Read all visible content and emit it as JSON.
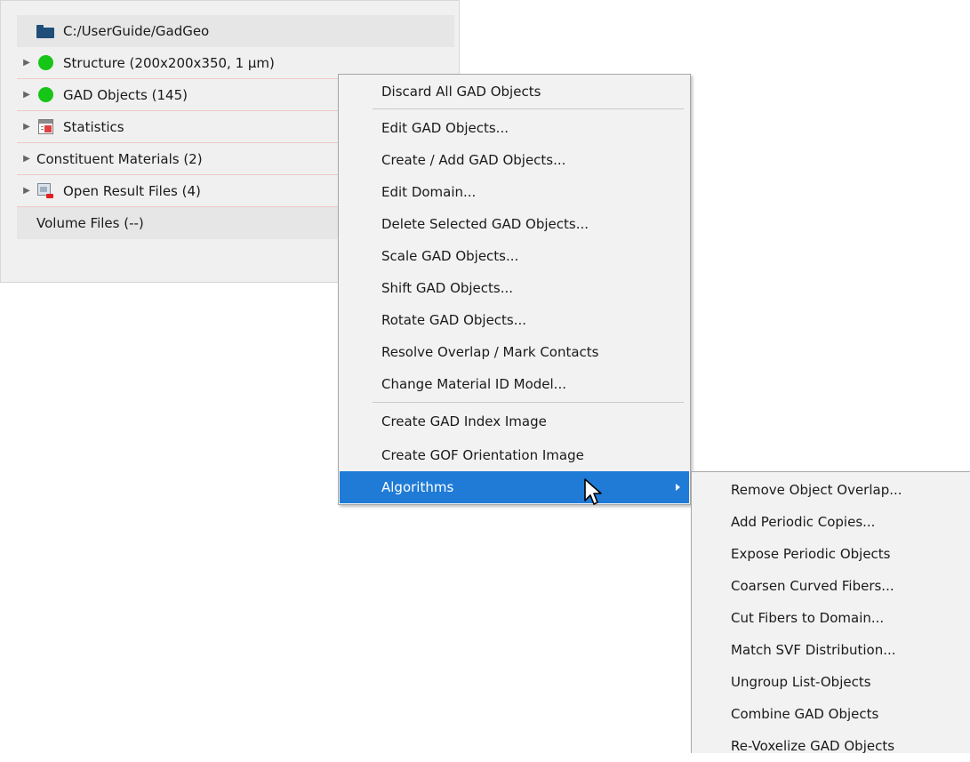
{
  "tree": {
    "root_path": "C:/UserGuide/GadGeo",
    "items": [
      {
        "label": "Structure (200x200x350, 1 µm)",
        "icon": "green-status-dot-icon"
      },
      {
        "label": "GAD Objects (145)",
        "icon": "green-status-dot-icon"
      },
      {
        "label": "Statistics",
        "icon": "statistics-icon"
      },
      {
        "label": "Constituent Materials (2)",
        "icon": ""
      },
      {
        "label": "Open Result Files (4)",
        "icon": "result-file-icon"
      },
      {
        "label": "Volume Files (--)",
        "icon": ""
      }
    ]
  },
  "context_menu": {
    "items": [
      "Discard All GAD Objects",
      "Edit GAD Objects...",
      "Create / Add GAD Objects...",
      "Edit Domain...",
      "Delete Selected GAD Objects...",
      "Scale GAD Objects...",
      "Shift GAD Objects...",
      "Rotate GAD Objects...",
      "Resolve Overlap / Mark Contacts",
      "Change Material ID Model...",
      "Create GAD Index Image",
      "Create GOF Orientation Image",
      "Algorithms"
    ],
    "highlighted": "Algorithms",
    "highlight_color": "#1f7bd6"
  },
  "submenu": {
    "items": [
      "Remove Object Overlap...",
      "Add Periodic Copies...",
      "Expose Periodic Objects",
      "Coarsen Curved Fibers...",
      "Cut Fibers to Domain...",
      "Match SVF Distribution...",
      "Ungroup List-Objects",
      "Combine GAD Objects",
      "Re-Voxelize GAD Objects"
    ]
  },
  "colors": {
    "status_green": "#16c516",
    "folder_blue": "#1f4e79",
    "row_separator": "#f0c8c8"
  }
}
